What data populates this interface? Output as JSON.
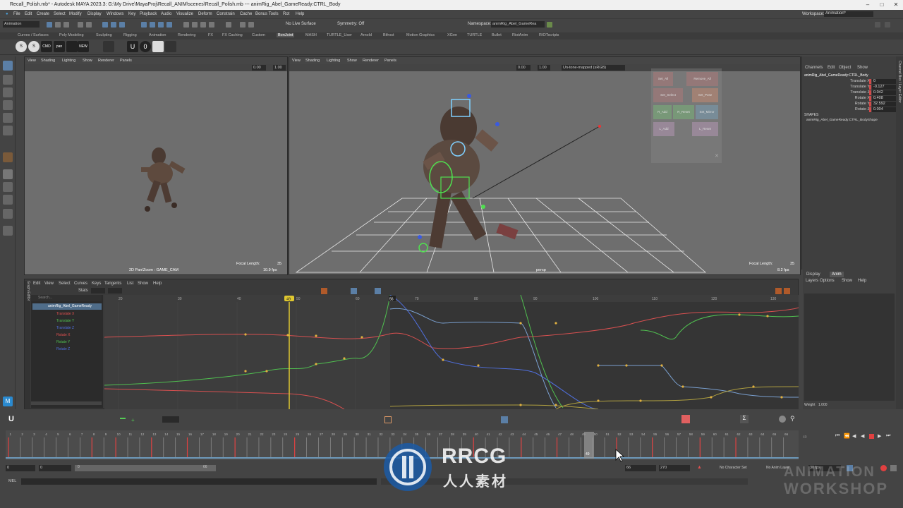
{
  "titlebar": {
    "title": "Recall_Polish.mb* - Autodesk MAYA 2023.3: G:\\My Drive\\MayaProj\\Recall_ANIM\\scenes\\Recall_Polish.mb   ---   animRig_Abel_GameReady:CTRL_Body"
  },
  "menu": [
    "File",
    "Edit",
    "Create",
    "Select",
    "Modify",
    "Display",
    "Windows",
    "Key",
    "Playback",
    "Audio",
    "Visualize",
    "Deform",
    "Constrain",
    "Cache",
    "Bonus Tools",
    "Rot",
    "Help"
  ],
  "workspace": {
    "label": "Workspace:",
    "value": "Animation*"
  },
  "status": {
    "mode": "Animation",
    "live_surface": "No Live Surface",
    "symmetry": "Symmetry: Off",
    "namespace_label": "Namespace:",
    "namespace_value": "animRig_Abel_GameRea"
  },
  "shelf_tabs": [
    "Curves / Surfaces",
    "Poly Modeling",
    "Sculpting",
    "Rigging",
    "Animation",
    "Rendering",
    "FX",
    "FX Caching",
    "Custom",
    "BonJoint",
    "MASH",
    "TURTLE_User",
    "Arnold",
    "Bifrost",
    "Motion Graphics",
    "XGen",
    "TURTLE",
    "Bullet",
    "RiotAnim",
    "RIOTscripts"
  ],
  "shelf_buttons": [
    "S",
    "S",
    "CMD",
    "pan",
    "NEW",
    "U",
    "0"
  ],
  "viewport_left": {
    "menu": [
      "View",
      "Shading",
      "Lighting",
      "Show",
      "Renderer",
      "Panels"
    ],
    "field_a": "0.00",
    "field_b": "1.00",
    "caption": "2D Pan/Zoom : GAME_CAM",
    "focal_label": "Focal Length:",
    "focal_value": "35",
    "fps": "10.9 fps"
  },
  "viewport_right": {
    "menu": [
      "View",
      "Shading",
      "Lighting",
      "Show",
      "Renderer",
      "Panels"
    ],
    "field_a": "0.00",
    "field_b": "1.00",
    "colorspace": "Un-tone-mapped (sRGB)",
    "camera": "persp",
    "focal_label": "Focal Length:",
    "focal_value": "35",
    "fps": "8.2 fps",
    "picker": [
      "Set_All",
      "Remove_All",
      "Set_Select",
      "Set_Pose",
      "R_Add",
      "R_Reset",
      "Set_Mirror",
      "L_Add",
      "L_Reset"
    ]
  },
  "channelbox": {
    "tabs": [
      "Channels",
      "Edit",
      "Object",
      "Show"
    ],
    "node": "animRig_Abel_GameReady:CTRL_Body",
    "channels": [
      {
        "name": "Translate X",
        "value": "0"
      },
      {
        "name": "Translate Y",
        "value": "-0.127"
      },
      {
        "name": "Translate Z",
        "value": "0.042"
      },
      {
        "name": "Rotate X",
        "value": "0.408"
      },
      {
        "name": "Rotate Y",
        "value": "32.592"
      },
      {
        "name": "Rotate Z",
        "value": "0.004"
      }
    ],
    "shapes_label": "SHAPES",
    "shape": "animRig_Abel_GameReady:CTRL_BodyShape",
    "side_tabs": "Channel Box / Layer Editor"
  },
  "layers": {
    "tabs": [
      "Display",
      "Anim"
    ],
    "menu": [
      "Layers",
      "Options",
      "Show",
      "Help"
    ],
    "weight_label": "Weight",
    "weight_value": "1.000"
  },
  "graph_editor": {
    "side_label": "Graph Editor",
    "menu": [
      "Edit",
      "View",
      "Select",
      "Curves",
      "Keys",
      "Tangents",
      "List",
      "Show",
      "Help"
    ],
    "stats_label": "Stats",
    "search_placeholder": "Search...",
    "root": "animRig_Abel_GameReady",
    "curves": [
      {
        "name": "Translate X",
        "color": "#e05050"
      },
      {
        "name": "Translate Y",
        "color": "#50c050"
      },
      {
        "name": "Translate Z",
        "color": "#5070e0"
      },
      {
        "name": "Rotate X",
        "color": "#e05050"
      },
      {
        "name": "Rotate Y",
        "color": "#50c050"
      },
      {
        "name": "Rotate Z",
        "color": "#5070e0"
      }
    ],
    "ruler": [
      "20",
      "30",
      "40",
      "50",
      "60",
      "70",
      "80",
      "90",
      "100",
      "110",
      "120",
      "130"
    ],
    "current_frame": "49",
    "key_marker": "56"
  },
  "timeline": {
    "ticks": [
      "1",
      "2",
      "3",
      "4",
      "5",
      "6",
      "7",
      "8",
      "9",
      "10",
      "11",
      "12",
      "13",
      "14",
      "15",
      "16",
      "17",
      "18",
      "19",
      "20",
      "21",
      "22",
      "23",
      "24",
      "25",
      "26",
      "27",
      "28",
      "29",
      "30",
      "31",
      "32",
      "33",
      "34",
      "35",
      "36",
      "37",
      "38",
      "39",
      "40",
      "41",
      "42",
      "43",
      "44",
      "45",
      "46",
      "47",
      "48",
      "49",
      "50",
      "51",
      "52",
      "53",
      "54",
      "55",
      "56",
      "57",
      "58",
      "59",
      "60",
      "61",
      "62",
      "63",
      "64",
      "65",
      "66"
    ],
    "current": "49",
    "right_field": "49"
  },
  "range": {
    "start": "0",
    "anim_start": "0",
    "slider_start": "0",
    "slider_end": "66",
    "end": "66",
    "anim_end": "270",
    "character": "No Character Set",
    "anim_layer": "No Anim Layer",
    "fps": "30 fps"
  },
  "cmdline": {
    "label": "MEL"
  },
  "watermark": {
    "logo": "RRCG",
    "sub": "人人素材",
    "right_top": "ANIMATION",
    "right_bottom": "WORKSHOP"
  }
}
